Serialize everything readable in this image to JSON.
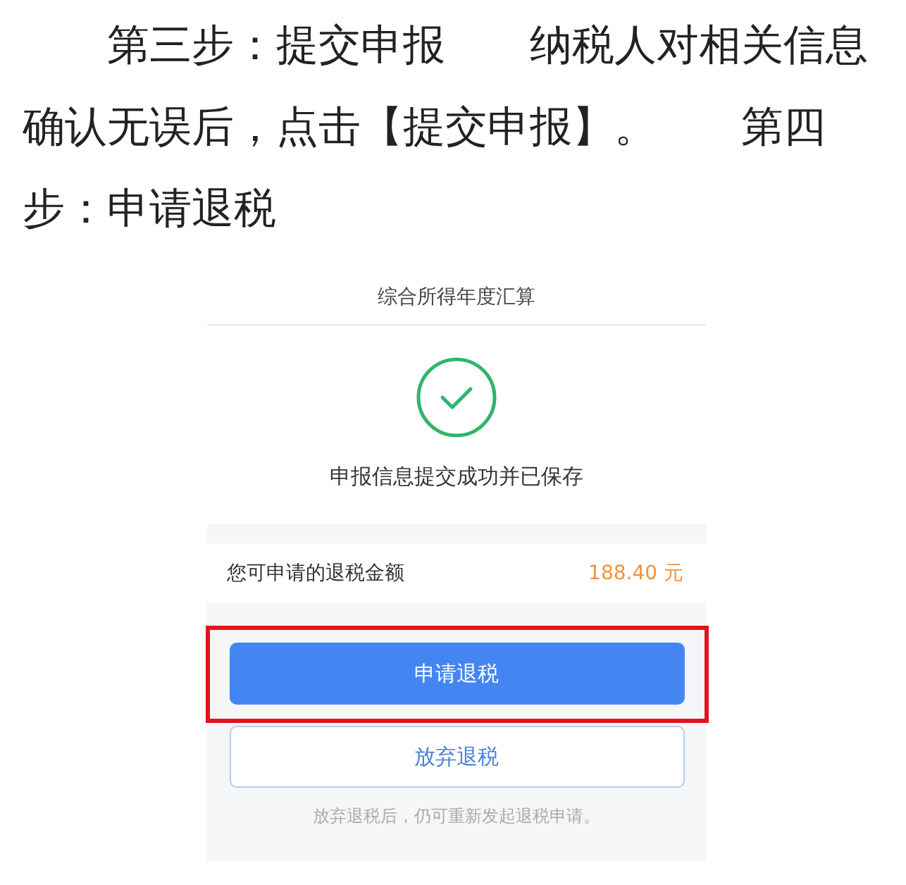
{
  "article": {
    "paragraph": "第三步：提交申报　　纳税人对相关信息确认无误后，点击【提交申报】。　　第四步：申请退税"
  },
  "screenshot": {
    "title": "综合所得年度汇算",
    "status_message": "申报信息提交成功并已保存",
    "refund_row": {
      "label": "您可申请的退税金额",
      "amount": "188.40",
      "unit": "元"
    },
    "buttons": [
      {
        "label": "申请退税",
        "kind": "primary",
        "highlighted": true
      },
      {
        "label": "放弃退税",
        "kind": "outline",
        "highlighted": false
      }
    ],
    "hint": "放弃退税后，仍可重新发起退税申请。"
  }
}
